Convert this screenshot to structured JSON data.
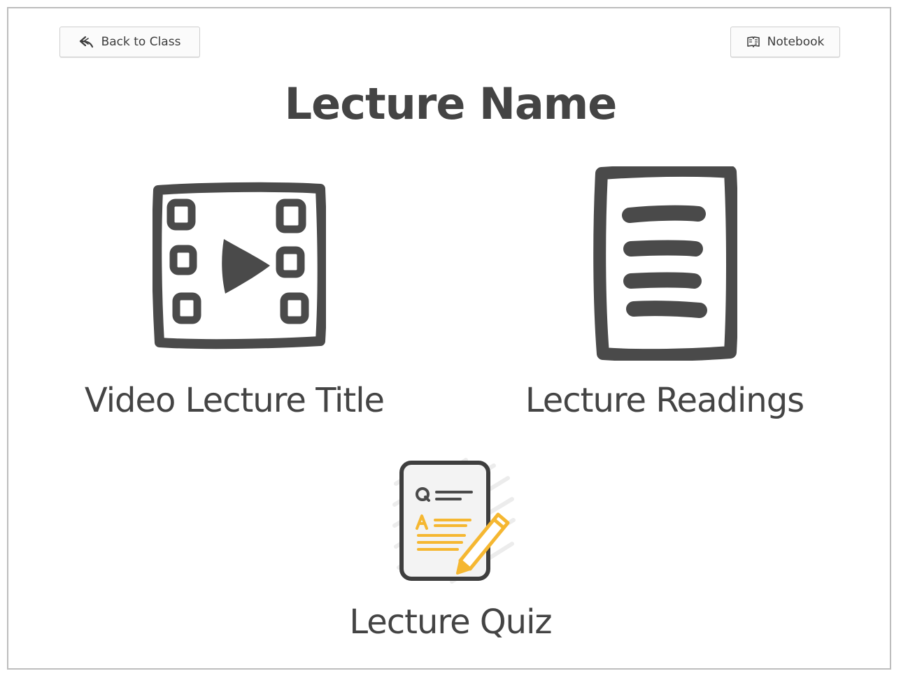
{
  "toolbar": {
    "back_label": "Back to Class",
    "back_icon": "reply-arrow-icon",
    "notebook_label": "Notebook",
    "notebook_icon": "notebook-icon"
  },
  "page": {
    "title": "Lecture Name"
  },
  "items": [
    {
      "label": "Video Lecture Title",
      "icon": "film-play-icon"
    },
    {
      "label": "Lecture Readings",
      "icon": "document-lines-icon"
    },
    {
      "label": "Lecture Quiz",
      "icon": "quiz-sheet-icon"
    }
  ],
  "colors": {
    "ink": "#4a4a4a",
    "quiz_accent": "#f5b731",
    "border": "#bdbdbd"
  }
}
